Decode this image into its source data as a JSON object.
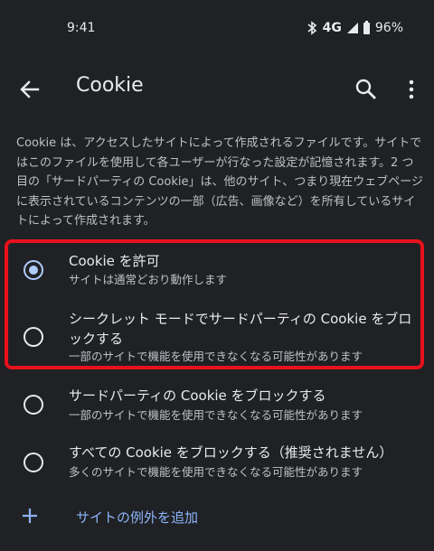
{
  "status": {
    "time": "9:41",
    "network": "4G",
    "battery": "96%"
  },
  "header": {
    "title": "Cookie"
  },
  "description": "Cookie は、アクセスしたサイトによって作成されるファイルです。サイトではこのファイルを使用して各ユーザーが行なった設定が記憶されます。2 つ目の「サードパーティの Cookie」は、他のサイト、つまり現在ウェブページに表示されているコンテンツの一部（広告、画像など）を所有しているサイトによって作成されます。",
  "options": [
    {
      "title": "Cookie を許可",
      "subtitle": "サイトは通常どおり動作します",
      "selected": true
    },
    {
      "title": "シークレット モードでサードパーティの Cookie をブロックする",
      "subtitle": "一部のサイトで機能を使用できなくなる可能性があります",
      "selected": false
    },
    {
      "title": "サードパーティの Cookie をブロックする",
      "subtitle": "一部のサイトで機能を使用できなくなる可能性があります",
      "selected": false
    },
    {
      "title": "すべての Cookie をブロックする（推奨されません）",
      "subtitle": "多くのサイトで機能を使用できなくなる可能性があります",
      "selected": false
    }
  ],
  "add_exception": {
    "label": "サイトの例外を追加"
  },
  "colors": {
    "background": "#202124",
    "accent": "#8ab4f8",
    "radio_selected": "#aecbfa",
    "highlight": "#e8111b"
  }
}
